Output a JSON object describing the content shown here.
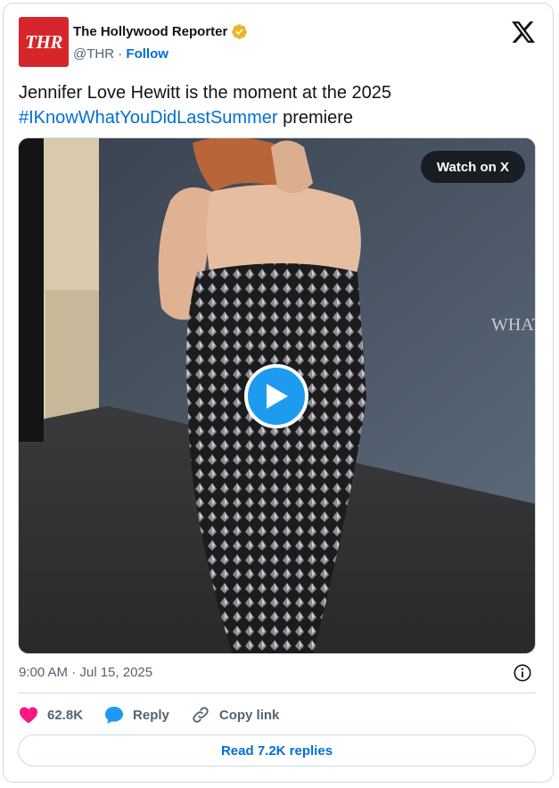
{
  "author": {
    "avatar_text": "THR",
    "name": "The Hollywood Reporter",
    "handle": "@THR",
    "separator": " · ",
    "follow_label": "Follow"
  },
  "tweet": {
    "text_before": "Jennifer Love Hewitt is the moment at the 2025 ",
    "hashtag": "#IKnowWhatYouDidLastSummer",
    "text_after": " premiere"
  },
  "media": {
    "watch_label": "Watch on X"
  },
  "meta": {
    "timestamp": "9:00 AM · Jul 15, 2025"
  },
  "actions": {
    "likes": "62.8K",
    "reply_label": "Reply",
    "copy_label": "Copy link"
  },
  "read_replies_label": "Read 7.2K replies",
  "colors": {
    "brand_red": "#d7262b",
    "link_blue": "#006fd6",
    "play_blue": "#1d9bf0",
    "like_pink": "#f91880"
  }
}
